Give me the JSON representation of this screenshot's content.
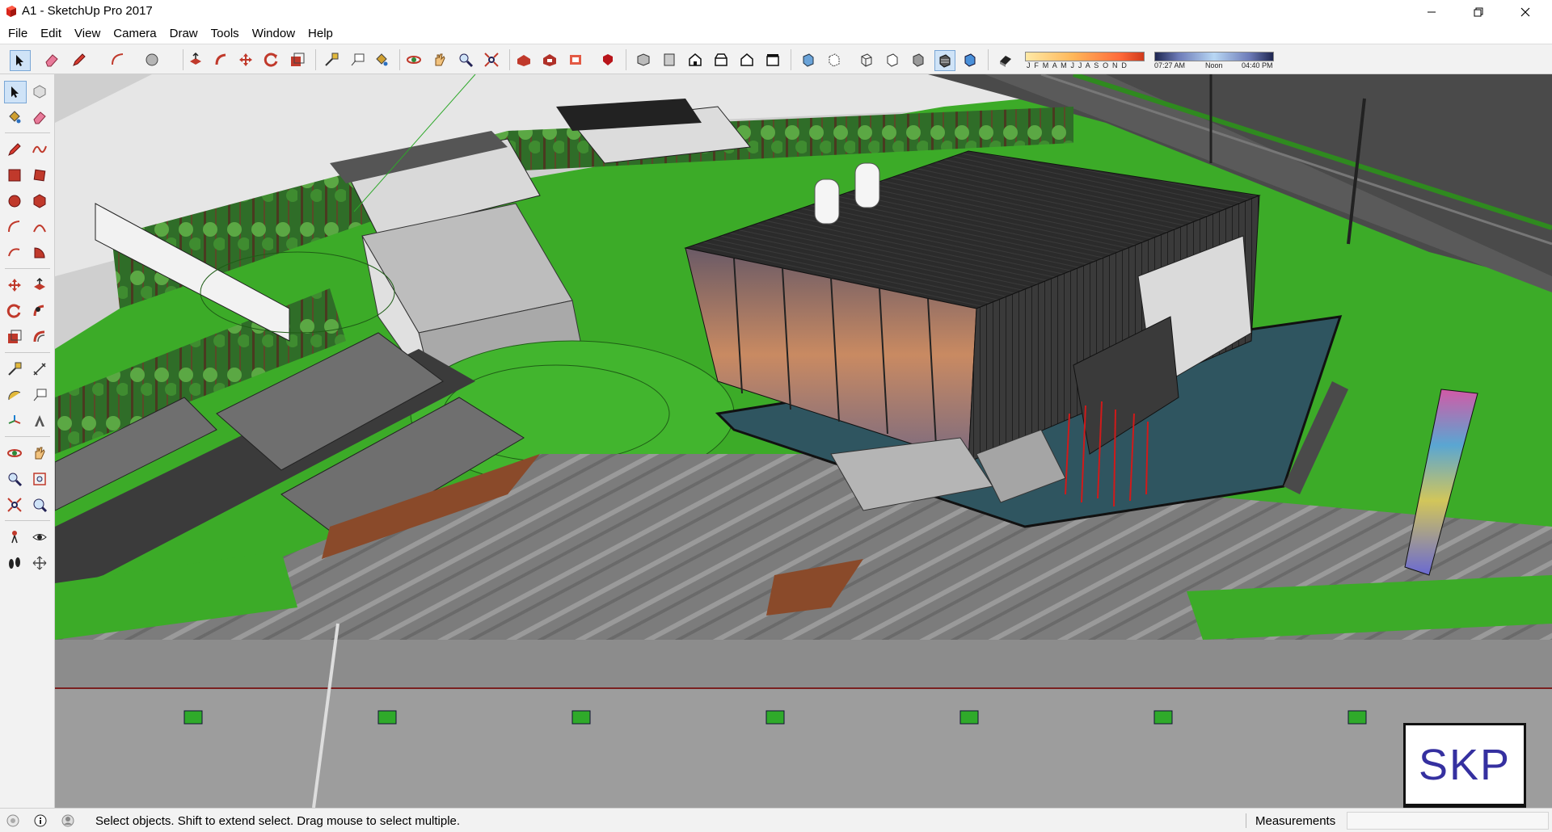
{
  "window": {
    "title": "A1 - SketchUp Pro 2017",
    "controls": [
      "minimize",
      "restore",
      "close"
    ]
  },
  "menu": {
    "items": [
      {
        "id": "file",
        "label": "File"
      },
      {
        "id": "edit",
        "label": "Edit"
      },
      {
        "id": "view",
        "label": "View"
      },
      {
        "id": "camera",
        "label": "Camera"
      },
      {
        "id": "draw",
        "label": "Draw"
      },
      {
        "id": "tools",
        "label": "Tools"
      },
      {
        "id": "window",
        "label": "Window"
      },
      {
        "id": "help",
        "label": "Help"
      }
    ]
  },
  "toolbar": {
    "tools": [
      "select-icon",
      "eraser-icon",
      "pencil-icon",
      "arc-icon",
      "circle-icon",
      "push-pull-icon",
      "follow-me-icon",
      "move-icon",
      "rotate-icon",
      "scale-icon",
      "tape-measure-icon",
      "text-icon",
      "paint-bucket-icon",
      "orbit-icon",
      "pan-icon",
      "zoom-icon",
      "zoom-extents-icon",
      "warehouse-icon",
      "extension-warehouse-icon",
      "layout-icon",
      "ruby-icon",
      "iso-view-icon",
      "top-view-icon",
      "front-view-icon",
      "right-view-icon",
      "back-view-icon",
      "left-view-icon",
      "xray-icon",
      "back-edges-icon",
      "wireframe-icon",
      "hidden-line-icon",
      "shaded-icon",
      "shaded-textures-icon",
      "monochrome-icon",
      "shadows-icon"
    ],
    "shadow_months": "J F M A M J J A S O N D",
    "time_start": "07:27 AM",
    "time_noon": "Noon",
    "time_end": "04:40 PM"
  },
  "palette": {
    "tools": [
      "select-icon",
      "component-icon",
      "paint-bucket-icon",
      "eraser-icon",
      "line-icon",
      "freehand-icon",
      "rectangle-icon",
      "rotated-rectangle-icon",
      "circle-icon",
      "polygon-icon",
      "arc-icon",
      "two-point-arc-icon",
      "three-point-arc-icon",
      "pie-icon",
      "move-icon",
      "push-pull-icon",
      "rotate-icon",
      "follow-me-icon",
      "scale-icon",
      "offset-icon",
      "tape-measure-icon",
      "dimension-icon",
      "protractor-icon",
      "text-icon",
      "axes-icon",
      "3d-text-icon",
      "orbit-icon",
      "pan-icon",
      "zoom-icon",
      "zoom-window-icon",
      "zoom-extents-icon",
      "previous-view-icon",
      "position-camera-icon",
      "look-around-icon",
      "walk-icon",
      "section-plane-icon"
    ]
  },
  "colors": {
    "grass": "#3cab28",
    "grass_dark": "#2f8a1f",
    "paving": "#8a8a8a",
    "roof": "#2a2a2a",
    "water": "#2f5560",
    "wall": "#dcdcdc",
    "sky": "#cfcfcf"
  },
  "badge": {
    "text": "SKP"
  },
  "status": {
    "message": "Select objects. Shift to extend select. Drag mouse to select multiple.",
    "measurements_label": "Measurements",
    "measurements_value": ""
  }
}
